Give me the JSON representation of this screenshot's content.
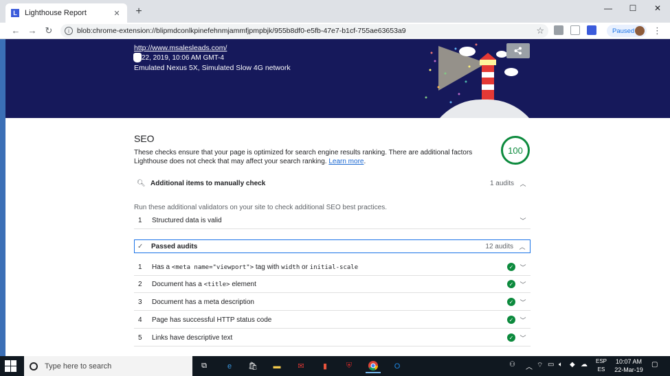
{
  "browser": {
    "tab_title": "Lighthouse Report",
    "tab_close": "✕",
    "new_tab": "+",
    "window": {
      "minimize": "—",
      "maximize": "☐",
      "close": "✕"
    },
    "url": "blob:chrome-extension://blipmdconlkpinefehnmjammfjpmpbjk/955b8df0-e5fb-47e7-b1cf-755ae63653a9",
    "paused_label": "Paused"
  },
  "banner": {
    "site_url": "http://www.msalesleads.com/",
    "date": "22, 2019, 10:06 AM GMT-4",
    "environment": "Emulated Nexus 5X, Simulated Slow 4G network"
  },
  "seo": {
    "title": "SEO",
    "description": "These checks ensure that your page is optimized for search engine results ranking. There are additional factors Lighthouse does not check that may affect your search ranking.",
    "learn_more": "Learn more",
    "score": "100",
    "manual": {
      "title": "Additional items to manually check",
      "count": "1 audits",
      "run_text": "Run these additional validators on your site to check additional SEO best practices.",
      "items": [
        {
          "num": "1",
          "text": "Structured data is valid"
        }
      ]
    },
    "passed": {
      "title": "Passed audits",
      "count": "12 audits",
      "items": [
        {
          "num": "1",
          "pre": "Has a ",
          "code1": "<meta name=\"viewport\">",
          "mid": " tag with ",
          "code2": "width",
          "mid2": " or ",
          "code3": "initial-scale"
        },
        {
          "num": "2",
          "pre": "Document has a ",
          "code1": "<title>",
          "mid": " element"
        },
        {
          "num": "3",
          "text": "Document has a meta description"
        },
        {
          "num": "4",
          "text": "Page has successful HTTP status code"
        },
        {
          "num": "5",
          "text": "Links have descriptive text"
        }
      ]
    }
  },
  "taskbar": {
    "search_placeholder": "Type here to search",
    "lang_top": "ESP",
    "lang_bottom": "ES",
    "time": "10:07 AM",
    "date": "22-Mar-19"
  },
  "colors": {
    "banner": "#16195b",
    "pass": "#0c8a3d",
    "link": "#1967d2"
  }
}
